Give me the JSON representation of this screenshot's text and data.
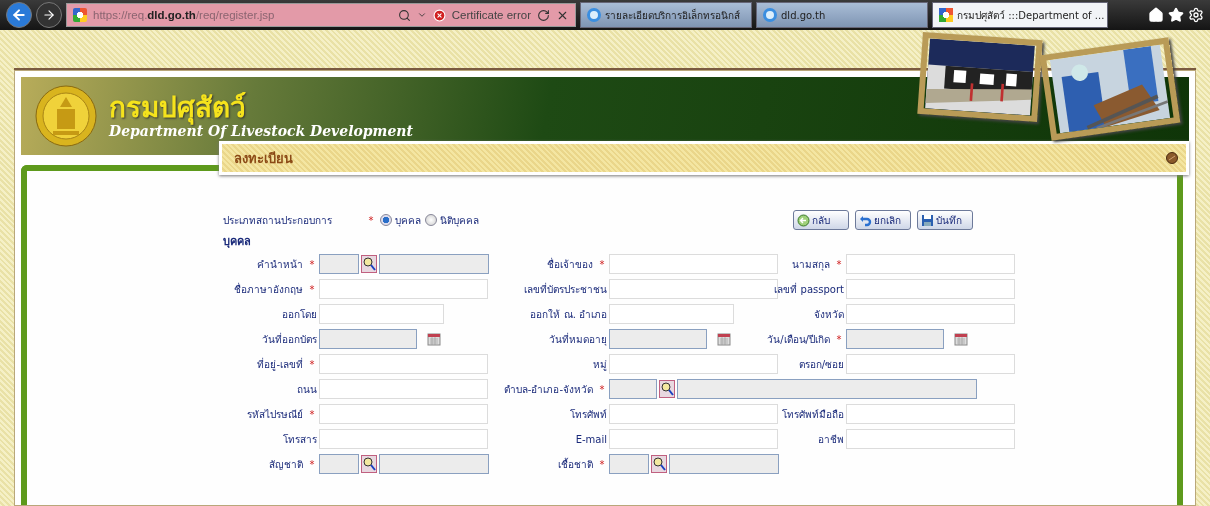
{
  "browser": {
    "address": "https://req.**dld.go.th**/req/register.jsp",
    "certificate_error": "Certificate error",
    "tabs": [
      {
        "title": "รายละเอียดบริการอิเล็กทรอนิกส์",
        "selected": false
      },
      {
        "title": "dld.go.th",
        "selected": false
      },
      {
        "title": "กรมปศุสัตว์ :::Department of ...",
        "selected": true
      }
    ]
  },
  "required_mark": "*",
  "header": {
    "title": "กรมปศุสัตว์",
    "subtitle": "Department Of Livestock Development"
  },
  "section": {
    "title": "ลงทะเบียน"
  },
  "business_type": {
    "label": "ประเภทสถานประกอบการ",
    "required": true,
    "options": [
      {
        "label": "บุคคล",
        "selected": true
      },
      {
        "label": "นิติบุคคล",
        "selected": false
      }
    ]
  },
  "buttons": [
    {
      "label": "กลับ",
      "kind": "back"
    },
    {
      "label": "ยกเลิก",
      "kind": "cancel"
    },
    {
      "label": "บันทึก",
      "kind": "save"
    }
  ],
  "group_title": "บุคคล",
  "rows": [
    [
      {
        "label": "คำนำหน้า",
        "required": true,
        "kind": "lookup"
      },
      {
        "label": "ชื่อเจ้าของ",
        "required": true,
        "kind": "text"
      },
      {
        "label": "นามสกุล",
        "required": true,
        "kind": "text"
      }
    ],
    [
      {
        "label": "ชื่อภาษาอังกฤษ",
        "required": true,
        "kind": "text"
      },
      {
        "label": "เลขที่บัตรประชาชน",
        "required": false,
        "kind": "text"
      },
      {
        "label": "เลขที่  passport",
        "required": false,
        "kind": "text"
      }
    ],
    [
      {
        "label": "ออกโดย",
        "required": false,
        "kind": "short"
      },
      {
        "label": "ออกให้  ณ. อำเภอ",
        "required": false,
        "kind": "short"
      },
      {
        "label": "จังหวัด",
        "required": false,
        "kind": "text"
      }
    ],
    [
      {
        "label": "วันที่ออกบัตร",
        "required": false,
        "kind": "date"
      },
      {
        "label": "วันที่หมดอายุ",
        "required": false,
        "kind": "date"
      },
      {
        "label": "วัน/เดือน/ปีเกิด",
        "required": true,
        "kind": "date"
      }
    ],
    [
      {
        "label": "ที่อยู่-เลขที่",
        "required": true,
        "kind": "text"
      },
      {
        "label": "หมู่",
        "required": false,
        "kind": "text"
      },
      {
        "label": "ตรอก/ซอย",
        "required": false,
        "kind": "text"
      }
    ],
    [
      {
        "label": "ถนน",
        "required": false,
        "kind": "text"
      },
      {
        "label": "ตำบล-อำเภอ-จังหวัด",
        "required": true,
        "kind": "lookup-wide"
      }
    ],
    [
      {
        "label": "รหัสไปรษณีย์",
        "required": true,
        "kind": "text"
      },
      {
        "label": "โทรศัพท์",
        "required": false,
        "kind": "text"
      },
      {
        "label": "โทรศัพท์มือถือ",
        "required": false,
        "kind": "text"
      }
    ],
    [
      {
        "label": "โทรสาร",
        "required": false,
        "kind": "text"
      },
      {
        "label": "E-mail",
        "required": false,
        "kind": "text"
      },
      {
        "label": "อาชีพ",
        "required": false,
        "kind": "text"
      }
    ],
    [
      {
        "label": "สัญชาติ",
        "required": true,
        "kind": "lookup"
      },
      {
        "label": "เชื้อชาติ",
        "required": true,
        "kind": "lookup"
      }
    ]
  ]
}
